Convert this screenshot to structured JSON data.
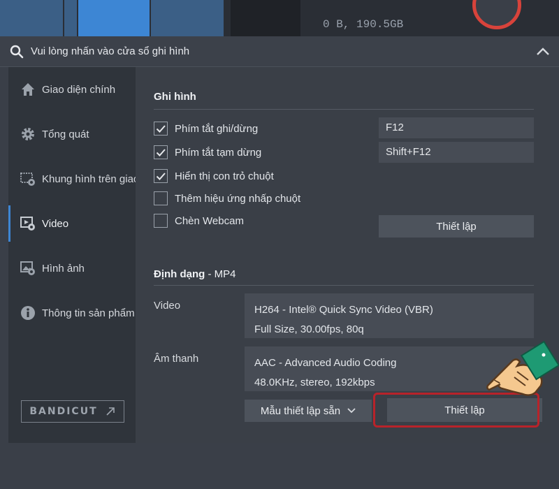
{
  "topbar": {
    "size_text": "0 B, 190.5GB"
  },
  "header": {
    "title": "Vui lòng nhấn vào cửa sổ ghi hình"
  },
  "sidebar": {
    "items": [
      {
        "label": "Giao diện chính",
        "icon": "home-icon"
      },
      {
        "label": "Tổng quát",
        "icon": "gear-icon"
      },
      {
        "label": "Khung hình trên giao diện",
        "icon": "frame-settings-icon"
      },
      {
        "label": "Video",
        "icon": "video-settings-icon"
      },
      {
        "label": "Hình ảnh",
        "icon": "image-settings-icon"
      },
      {
        "label": "Thông tin sản phẩm",
        "icon": "info-icon"
      }
    ],
    "active": "Video",
    "logo_text": "BANDICUT"
  },
  "record": {
    "title": "Ghi hình",
    "options": [
      {
        "label": "Phím tắt ghi/dừng",
        "checked": true
      },
      {
        "label": "Phím tắt tạm dừng",
        "checked": true
      },
      {
        "label": "Hiển thị con trỏ chuột",
        "checked": true
      },
      {
        "label": "Thêm hiệu ứng nhấp chuột",
        "checked": false
      },
      {
        "label": "Chèn Webcam",
        "checked": false
      }
    ],
    "hotkey_record": "F12",
    "hotkey_pause": "Shift+F12",
    "webcam_settings_button": "Thiết lập"
  },
  "format": {
    "title": "Định dạng",
    "separator": " - ",
    "container": "MP4",
    "video_label": "Video",
    "video_line1": "H264 - Intel® Quick Sync Video (VBR)",
    "video_line2": "Full Size, 30.00fps, 80q",
    "audio_label": "Âm thanh",
    "audio_line1": "AAC - Advanced Audio Coding",
    "audio_line2": "48.0KHz, stereo, 192kbps",
    "presets_button": "Mẫu thiết lập sẵn",
    "settings_button": "Thiết lập"
  },
  "colors": {
    "accent": "#3d86d4",
    "highlight": "#b8232a"
  }
}
